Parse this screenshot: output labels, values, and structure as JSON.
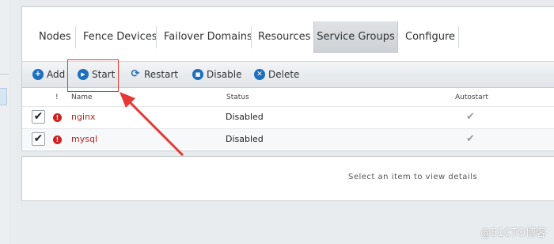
{
  "tabs": [
    {
      "label": "Nodes"
    },
    {
      "label": "Fence Devices"
    },
    {
      "label": "Failover Domains"
    },
    {
      "label": "Resources"
    },
    {
      "label": "Service Groups",
      "active": true
    },
    {
      "label": "Configure"
    }
  ],
  "toolbar": {
    "add_label": "Add",
    "start_label": "Start",
    "restart_label": "Restart",
    "disable_label": "Disable",
    "delete_label": "Delete"
  },
  "table": {
    "headers": {
      "alert": "!",
      "name": "Name",
      "status": "Status",
      "autostart": "Autostart"
    },
    "rows": [
      {
        "checked": true,
        "name": "nginx",
        "status": "Disabled",
        "autostart": true
      },
      {
        "checked": true,
        "name": "mysql",
        "status": "Disabled",
        "autostart": true
      }
    ]
  },
  "details": {
    "empty_text": "Select an item to view details"
  },
  "watermark": "@51CTO博客",
  "colors": {
    "accent": "#1d6fbd",
    "error": "#d11f1f",
    "annotation": "#e53935"
  },
  "icons": {
    "add": "plus-circle-icon",
    "start": "play-circle-icon",
    "restart": "refresh-icon",
    "disable": "stop-circle-icon",
    "delete": "x-circle-icon",
    "alert": "exclamation-circle-icon",
    "check": "checkmark-icon"
  }
}
